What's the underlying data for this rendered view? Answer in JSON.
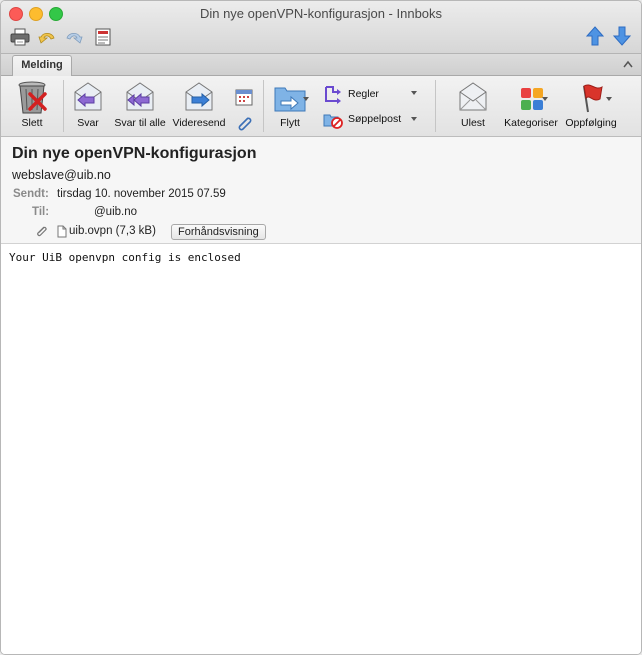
{
  "window": {
    "title": "Din nye openVPN-konfigurasjon - Innboks",
    "controls": [
      "close-icon",
      "minimize-icon",
      "zoom-icon"
    ]
  },
  "quick_access": {
    "icons": [
      "print-icon",
      "undo-icon",
      "redo-icon",
      "more-options-icon"
    ],
    "nav": [
      "up-arrow-icon",
      "down-arrow-icon"
    ]
  },
  "ribbon": {
    "tab": "Melding",
    "buttons": {
      "delete": "Slett",
      "reply": "Svar",
      "reply_all": "Svar til alle",
      "forward": "Videresend",
      "move": "Flytt",
      "rules": "Regler",
      "junk": "Søppelpost",
      "unread": "Ulest",
      "categorize": "Kategoriser",
      "followup": "Oppfølging"
    },
    "accent": "#3b7fd6",
    "flag_color": "#d9342b"
  },
  "message": {
    "subject": "Din nye openVPN-konfigurasjon",
    "from": "webslave@uib.no",
    "sent_label": "Sendt:",
    "sent_value": "tirsdag 10. november 2015 07.59",
    "to_label": "Til:",
    "to_value": "@uib.no",
    "attachment": {
      "name": "uib.ovpn (7,3 kB)",
      "preview_label": "Forhåndsvisning"
    },
    "body": "Your UiB openvpn config is enclosed"
  }
}
